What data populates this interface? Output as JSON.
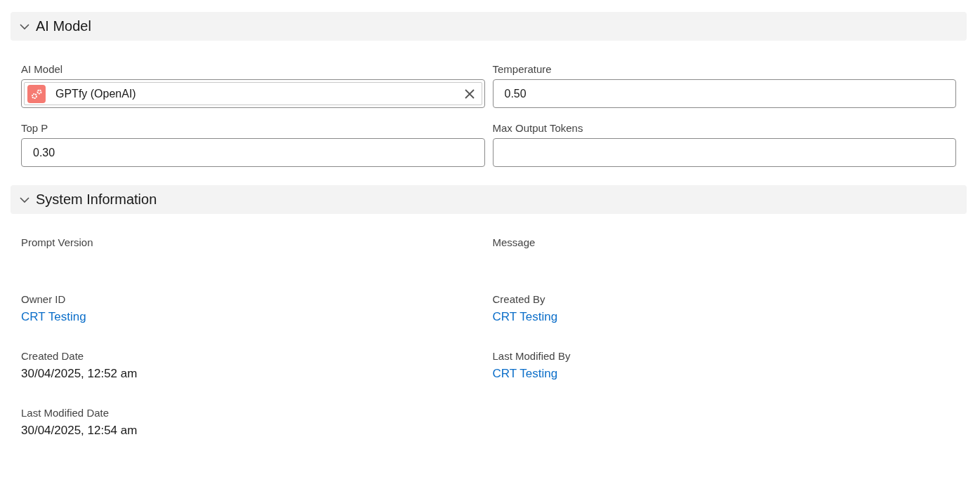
{
  "sections": [
    {
      "title": "AI Model",
      "expanded": true,
      "rows": [
        [
          {
            "label": "AI Model",
            "kind": "lookup",
            "value": "GPTfy (OpenAI)"
          },
          {
            "label": "Temperature",
            "kind": "input",
            "value": "0.50"
          }
        ],
        [
          {
            "label": "Top P",
            "kind": "input",
            "value": "0.30"
          },
          {
            "label": "Max Output Tokens",
            "kind": "input"
          }
        ]
      ]
    },
    {
      "title": "System Information",
      "expanded": true,
      "rows": [
        [
          {
            "label": "Prompt Version",
            "kind": "text"
          },
          {
            "label": "Message",
            "kind": "text"
          }
        ],
        [
          {
            "label": "Owner ID",
            "kind": "link",
            "value": "CRT Testing"
          },
          {
            "label": "Created By",
            "kind": "link",
            "value": "CRT Testing"
          }
        ],
        [
          {
            "label": "Created Date",
            "kind": "text",
            "value": "30/04/2025, 12:52 am"
          },
          {
            "label": "Last Modified By",
            "kind": "link",
            "value": "CRT Testing"
          }
        ],
        [
          {
            "label": "Last Modified Date",
            "kind": "text",
            "value": "30/04/2025, 12:54 am"
          }
        ]
      ]
    }
  ]
}
